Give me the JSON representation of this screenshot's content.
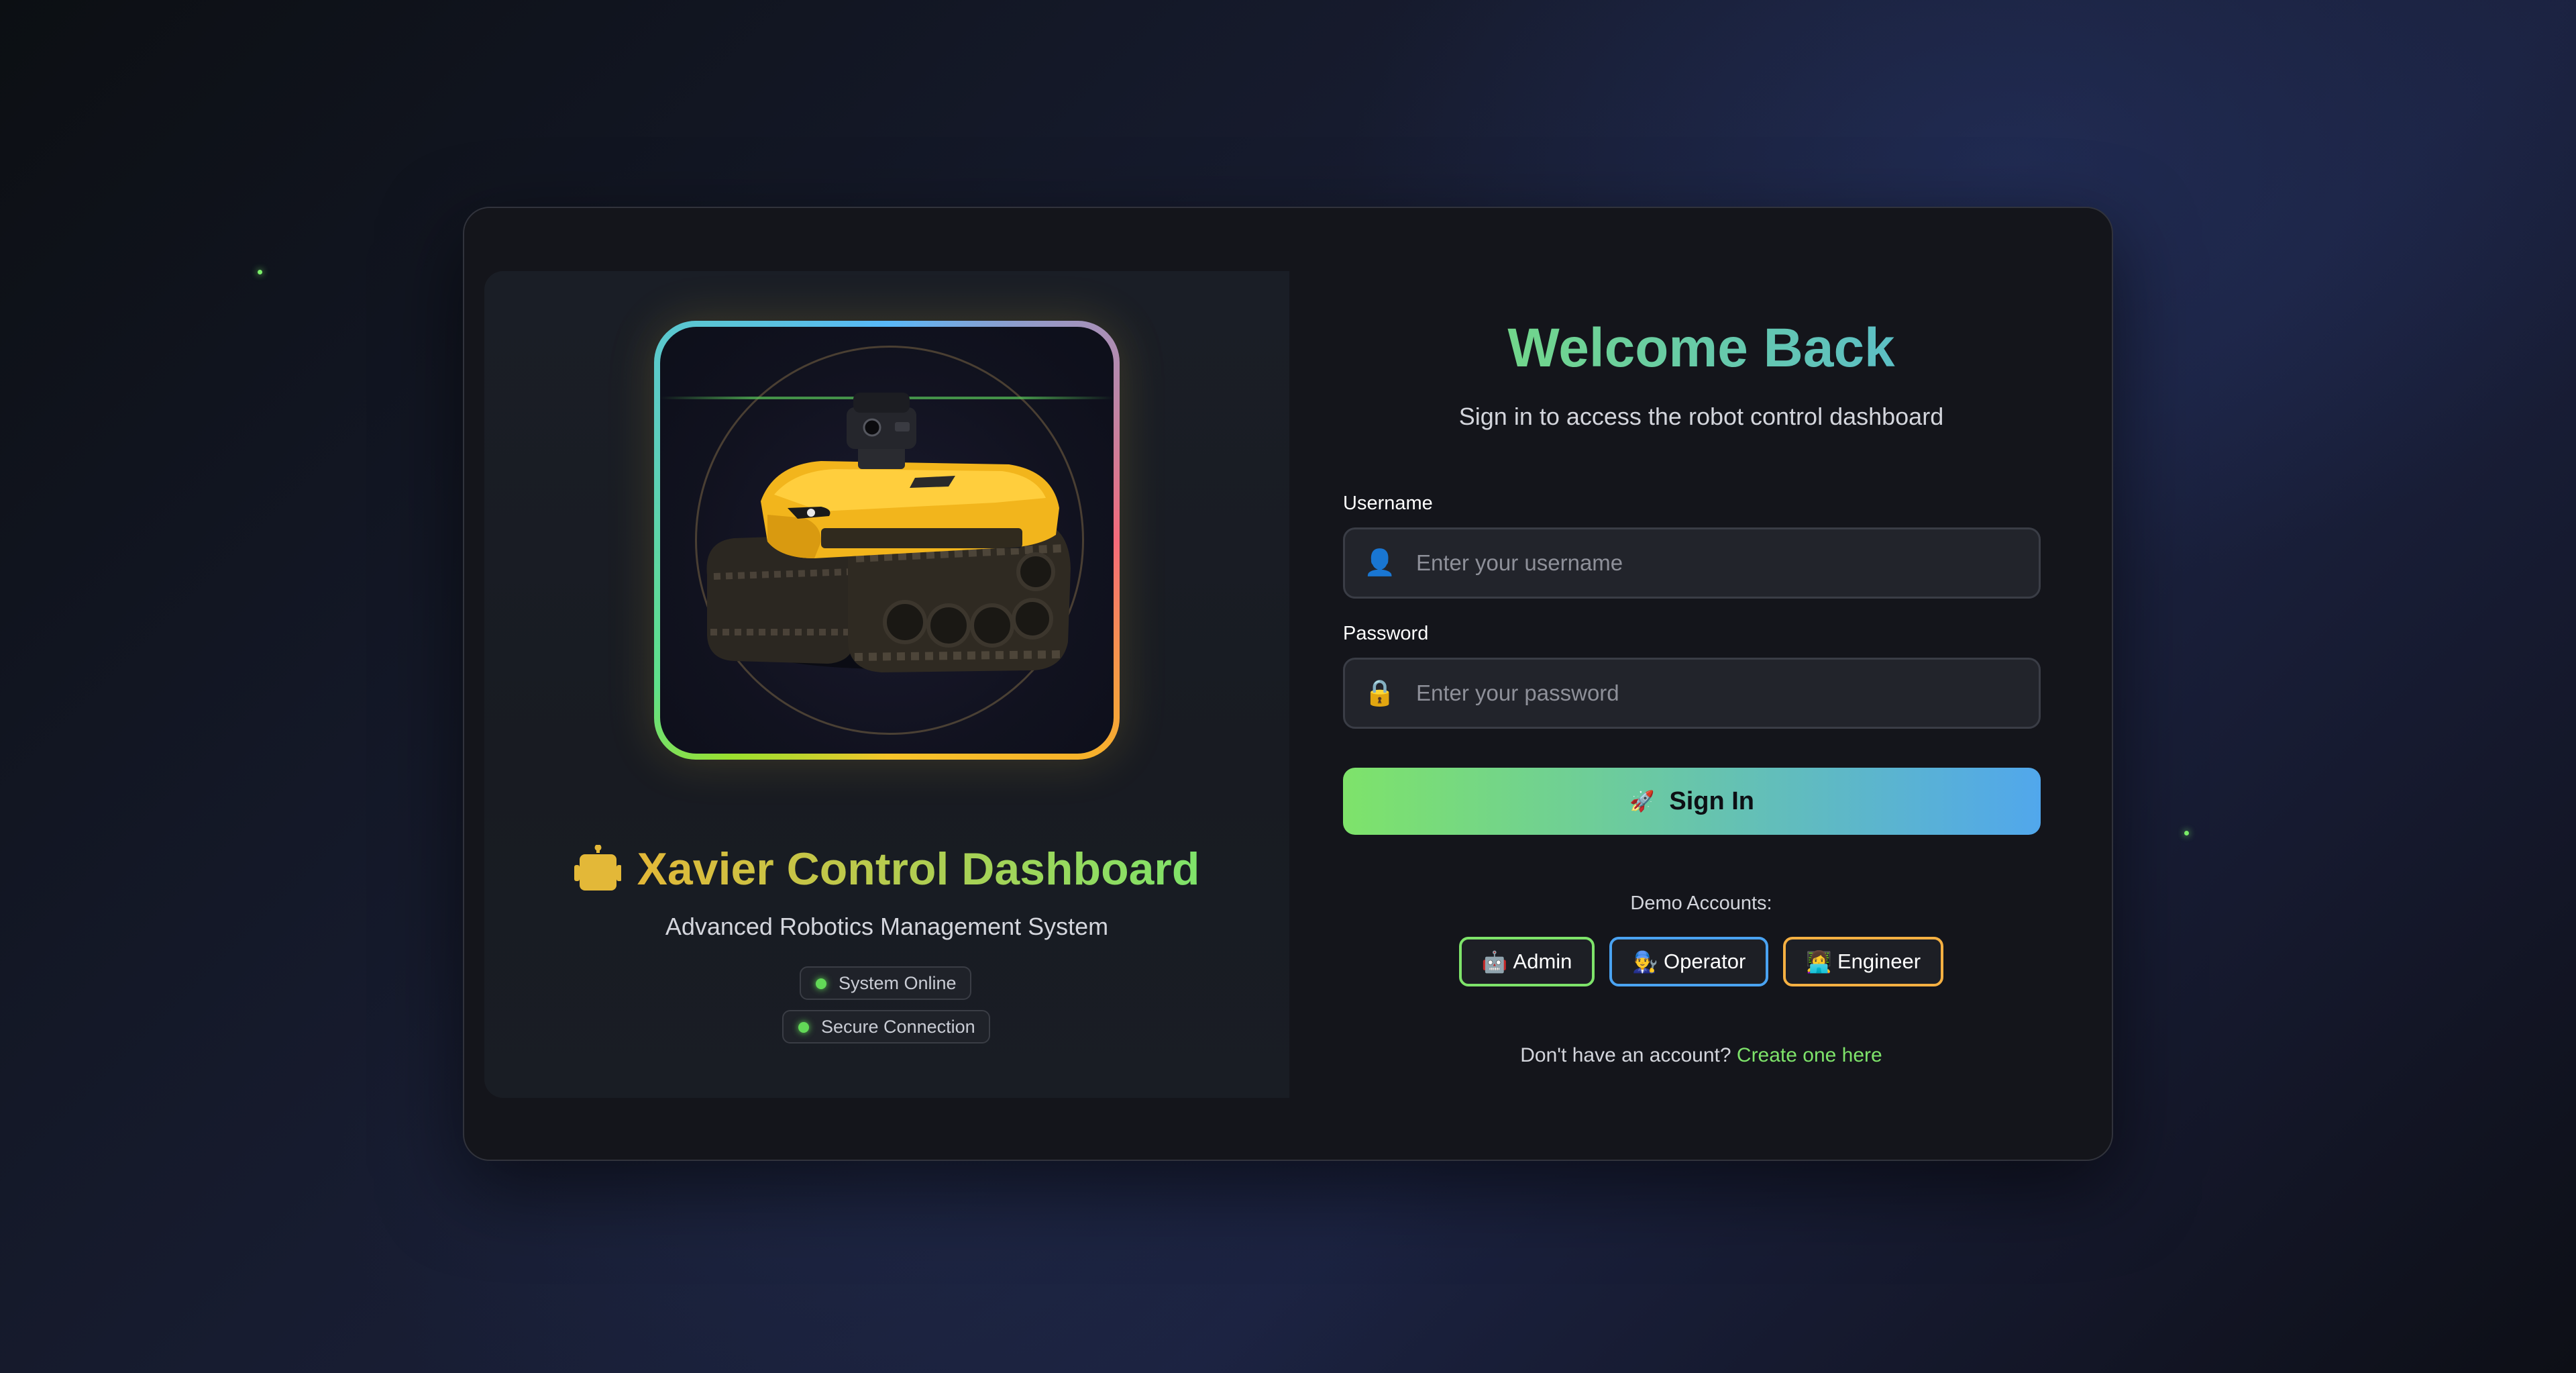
{
  "brand": {
    "title": "Xavier Control Dashboard",
    "subtitle": "Advanced Robotics Management System",
    "logo_icon": "robot-icon",
    "status_badges": [
      {
        "label": "System Online",
        "status": "online"
      },
      {
        "label": "Secure Connection",
        "status": "online"
      }
    ]
  },
  "login": {
    "heading": "Welcome Back",
    "subheading": "Sign in to access the robot control dashboard",
    "username": {
      "label": "Username",
      "placeholder": "Enter your username",
      "value": "",
      "icon": "user-icon",
      "glyph": "👤"
    },
    "password": {
      "label": "Password",
      "placeholder": "Enter your password",
      "value": "",
      "icon": "lock-icon",
      "glyph": "🔒"
    },
    "submit": {
      "icon": "rocket-icon",
      "glyph": "🚀",
      "label": "Sign In"
    }
  },
  "demo": {
    "label": "Demo Accounts:",
    "accounts": [
      {
        "glyph": "🤖",
        "label": "Admin",
        "color": "#7ee36a"
      },
      {
        "glyph": "👨‍🔧",
        "label": "Operator",
        "color": "#4aa3f2"
      },
      {
        "glyph": "👩‍💻",
        "label": "Engineer",
        "color": "#f5b042"
      }
    ]
  },
  "footer": {
    "text": "Don't have an account?",
    "link": "Create one here"
  },
  "colors": {
    "accent_green": "#7ee36a",
    "accent_blue": "#51a7ec",
    "accent_yellow": "#e3b838",
    "card_background": "#14151b",
    "status_online": "#62d957"
  }
}
